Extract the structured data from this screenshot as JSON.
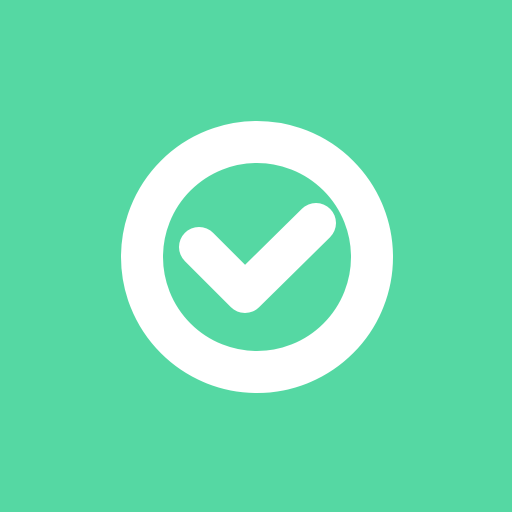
{
  "screen": {
    "background_color": "#55d8a3",
    "icon": {
      "name": "check-circle-icon",
      "ring_color": "#ffffff",
      "check_color": "#ffffff"
    }
  }
}
